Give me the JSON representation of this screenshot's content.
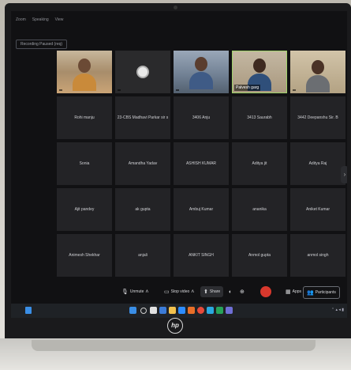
{
  "topbar": {
    "items": [
      "Zoom",
      "Speaking",
      "View"
    ]
  },
  "recording_label": "Recording Paused (req)",
  "tiles": [
    {
      "name": "",
      "kind": "video"
    },
    {
      "name": "",
      "kind": "logo"
    },
    {
      "name": "",
      "kind": "video"
    },
    {
      "name": "Palvesh garg",
      "kind": "video",
      "active": true
    },
    {
      "name": "",
      "kind": "video"
    },
    {
      "name": "Rohi manju",
      "kind": "name"
    },
    {
      "name": "23-CBS Madhavi Parkar sir s",
      "kind": "name"
    },
    {
      "name": "3406 Anju",
      "kind": "name"
    },
    {
      "name": "3413 Saurabh",
      "kind": "name"
    },
    {
      "name": "3442 Deepanshu Sir. B",
      "kind": "name"
    },
    {
      "name": "Sonia",
      "kind": "name"
    },
    {
      "name": "Amandha Yadav",
      "kind": "name"
    },
    {
      "name": "ASHISH KUMAR",
      "kind": "name"
    },
    {
      "name": "Aditya jit",
      "kind": "name"
    },
    {
      "name": "Aditya Raj",
      "kind": "name"
    },
    {
      "name": "Ajit pandey",
      "kind": "name"
    },
    {
      "name": "ak gupta",
      "kind": "name"
    },
    {
      "name": "Ambuj Kumar",
      "kind": "name"
    },
    {
      "name": "ananika",
      "kind": "name"
    },
    {
      "name": "Aniket Kumar",
      "kind": "name"
    },
    {
      "name": "Animesh Shekhar",
      "kind": "name"
    },
    {
      "name": "anjali",
      "kind": "name"
    },
    {
      "name": "ANKIT SINGH",
      "kind": "name"
    },
    {
      "name": "Anmol gupta",
      "kind": "name"
    },
    {
      "name": "anmol singh",
      "kind": "name"
    }
  ],
  "toolbar": {
    "unmute": "Unmute",
    "stop_video": "Stop video",
    "share": "Share",
    "apps": "Apps",
    "participants": "Participants"
  },
  "brand": "hp"
}
